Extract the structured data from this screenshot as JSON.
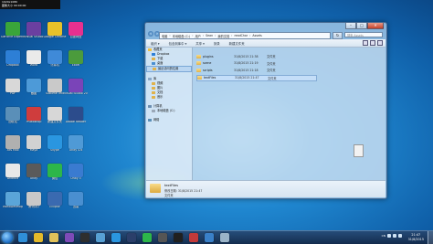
{
  "video_widget": {
    "line1": "1920x1080",
    "line2": "图像大小 00:00:00"
  },
  "desktop_icons": [
    {
      "label": "GeForce Experience",
      "color": "#3aa53a"
    },
    {
      "label": "Visual Studio",
      "color": "#6b3fa0"
    },
    {
      "label": "Google Chrome",
      "color": "#e8c22a"
    },
    {
      "label": "百度网盘",
      "color": "#e8308f"
    },
    {
      "label": "Dropbox",
      "color": "#2d7fd6"
    },
    {
      "label": "Word",
      "color": "#eaeaea"
    },
    {
      "label": "计算机",
      "color": "#3f8ad8"
    },
    {
      "label": "Excel",
      "color": "#4b9b3c"
    },
    {
      "label": "PDF",
      "color": "#d8d8d8"
    },
    {
      "label": "截图",
      "color": "#4d9ad8"
    },
    {
      "label": "Sublime Text",
      "color": "#c9c9c9"
    },
    {
      "label": "Visual Studio 2013",
      "color": "#7a44b8"
    },
    {
      "label": "回收站",
      "color": "#5a8fb8"
    },
    {
      "label": "Photoshop",
      "color": "#cf3d3d"
    },
    {
      "label": "新建文件夹",
      "color": "#d7d7d7"
    },
    {
      "label": "Adobe Reader",
      "color": "#2c4c8c"
    },
    {
      "label": "3ds Max",
      "color": "#b0b0b0"
    },
    {
      "label": "Maya",
      "color": "#d2d2d2"
    },
    {
      "label": "Skype",
      "color": "#2a96e0"
    },
    {
      "label": "Unity 4.6",
      "color": "#4f9ad6"
    },
    {
      "label": "Android",
      "color": "#e8e8e8"
    },
    {
      "label": "Unity",
      "color": "#5a5a5a"
    },
    {
      "label": "微信",
      "color": "#2db64a"
    },
    {
      "label": "Unity 5",
      "color": "#3a7bd0"
    },
    {
      "label": "MonoDevelop",
      "color": "#5aa5d8"
    },
    {
      "label": "腾讯QQ",
      "color": "#c8c8c8"
    },
    {
      "label": "Eclipse",
      "color": "#3a6ab0"
    },
    {
      "label": "迅雷",
      "color": "#4a8fd0"
    }
  ],
  "window": {
    "breadcrumbs": [
      "电脑",
      "本地磁盘 (C:)",
      "用户",
      "Sean",
      "我的文档",
      "readChar",
      "Assets"
    ],
    "search_placeholder": "搜索 Assets",
    "controls": {
      "minimize": "–",
      "maximize": "□",
      "close": "✕"
    },
    "toolbar": {
      "organize": "组织 ▾",
      "include_in_library": "包含到库中 ▾",
      "share": "共享 ▾",
      "burn": "刻录",
      "new_folder": "新建文件夹"
    },
    "nav": [
      {
        "label": "收藏夹",
        "kind": "favorites"
      },
      {
        "label": "Dropbox",
        "kind": "dropbox"
      },
      {
        "label": "下载",
        "kind": "folder"
      },
      {
        "label": "桌面",
        "kind": "desktop"
      },
      {
        "label": "最近访问的位置",
        "kind": "folder",
        "selected": true
      },
      {
        "label": "",
        "kind": "spacer"
      },
      {
        "label": "库",
        "kind": "library"
      },
      {
        "label": "视频",
        "kind": "folder"
      },
      {
        "label": "图片",
        "kind": "folder"
      },
      {
        "label": "文档",
        "kind": "folder"
      },
      {
        "label": "音乐",
        "kind": "folder"
      },
      {
        "label": "",
        "kind": "spacer"
      },
      {
        "label": "计算机",
        "kind": "computer"
      },
      {
        "label": "本地磁盘 (C:)",
        "kind": "drive"
      },
      {
        "label": "",
        "kind": "spacer"
      },
      {
        "label": "网络",
        "kind": "network"
      }
    ],
    "files": [
      {
        "name": "plugins",
        "date": "31/8/2015 21:38",
        "type": "文件夹"
      },
      {
        "name": "scene",
        "date": "31/8/2015 21:19",
        "type": "文件夹"
      },
      {
        "name": "scripts",
        "date": "31/8/2015 21:18",
        "type": "文件夹"
      },
      {
        "name": "textFiles",
        "date": "31/8/2015 21:47",
        "type": "文件夹",
        "selected": true
      }
    ],
    "details": {
      "name": "textFiles",
      "meta": "修改日期: 31/8/2015 21:47",
      "type": "文件夹"
    }
  },
  "taskbar": {
    "apps": [
      {
        "name": "Internet Explorer",
        "color": "#2f8fd8"
      },
      {
        "name": "Chrome",
        "color": "#e4b92a"
      },
      {
        "name": "Explorer",
        "color": "#e2c25a"
      },
      {
        "name": "Visual Studio",
        "color": "#7d4bb8"
      },
      {
        "name": "Unity",
        "color": "#2e2e2e"
      },
      {
        "name": "MonoDevelop",
        "color": "#57a0d4"
      },
      {
        "name": "Skype",
        "color": "#2a96e0"
      },
      {
        "name": "Photoshop",
        "color": "#2b3f6a"
      },
      {
        "name": "WeChat",
        "color": "#2db64a"
      },
      {
        "name": "Sublime",
        "color": "#555555"
      },
      {
        "name": "Terminal",
        "color": "#202020"
      },
      {
        "name": "PDF",
        "color": "#c43a3a"
      },
      {
        "name": "QQ",
        "color": "#3a80c8"
      },
      {
        "name": "Network",
        "color": "#9bb4c8"
      }
    ],
    "tray_label": "CN",
    "clock_time": "21:47",
    "clock_date": "31/8/2015"
  },
  "colors": {
    "wallpaper": "#1f86cf",
    "window_glass": "#aacdeb",
    "folder": "#e0b24a"
  }
}
